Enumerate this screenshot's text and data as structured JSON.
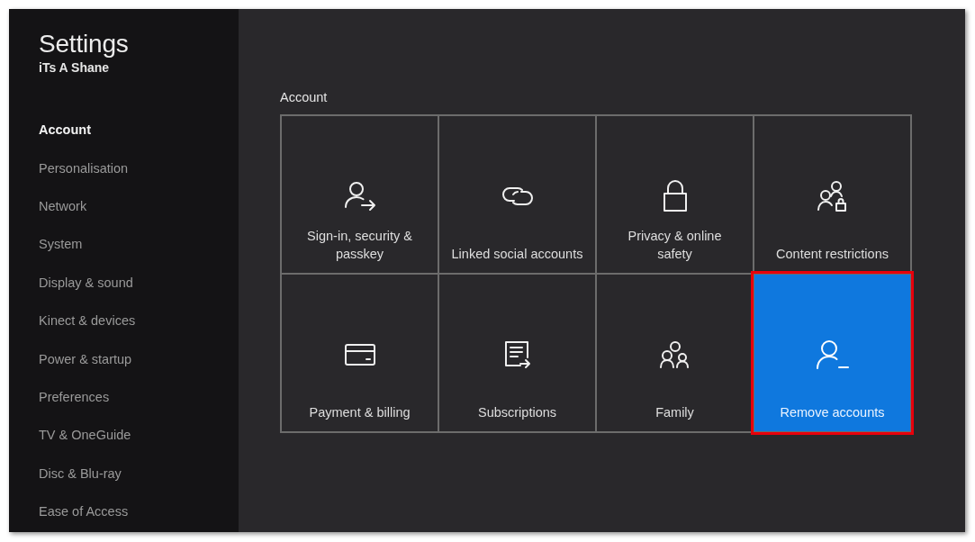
{
  "header": {
    "title": "Settings",
    "user": "iTs A Shane"
  },
  "sidebar": {
    "items": [
      {
        "label": "Account",
        "selected": true
      },
      {
        "label": "Personalisation",
        "selected": false
      },
      {
        "label": "Network",
        "selected": false
      },
      {
        "label": "System",
        "selected": false
      },
      {
        "label": "Display & sound",
        "selected": false
      },
      {
        "label": "Kinect & devices",
        "selected": false
      },
      {
        "label": "Power & startup",
        "selected": false
      },
      {
        "label": "Preferences",
        "selected": false
      },
      {
        "label": "TV & OneGuide",
        "selected": false
      },
      {
        "label": "Disc & Blu-ray",
        "selected": false
      },
      {
        "label": "Ease of Access",
        "selected": false
      }
    ]
  },
  "section": {
    "title": "Account",
    "tiles": [
      {
        "label": "Sign-in, security &\npasskey",
        "selected": false,
        "highlighted": false
      },
      {
        "label": "Linked social accounts",
        "selected": false,
        "highlighted": false
      },
      {
        "label": "Privacy & online\nsafety",
        "selected": false,
        "highlighted": false
      },
      {
        "label": "Content restrictions",
        "selected": false,
        "highlighted": false
      },
      {
        "label": "Payment & billing",
        "selected": false,
        "highlighted": false
      },
      {
        "label": "Subscriptions",
        "selected": false,
        "highlighted": false
      },
      {
        "label": "Family",
        "selected": false,
        "highlighted": false
      },
      {
        "label": "Remove accounts",
        "selected": true,
        "highlighted": true
      }
    ]
  }
}
